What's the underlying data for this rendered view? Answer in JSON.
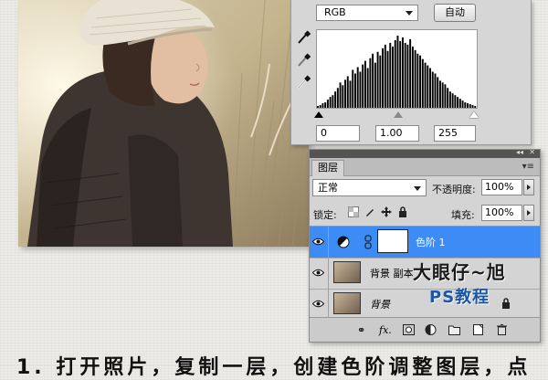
{
  "levels": {
    "channel": "RGB",
    "auto_label": "自动",
    "input_black": "0",
    "input_gamma": "1.00",
    "input_white": "255",
    "histogram_bins": [
      2,
      3,
      5,
      6,
      9,
      12,
      14,
      18,
      22,
      28,
      25,
      31,
      35,
      30,
      42,
      38,
      45,
      40,
      48,
      52,
      44,
      55,
      60,
      50,
      62,
      58,
      66,
      70,
      63,
      72,
      68,
      75,
      80,
      74,
      78,
      72,
      70,
      76,
      68,
      64,
      60,
      58,
      54,
      50,
      47,
      44,
      40,
      38,
      34,
      30,
      28,
      26,
      22,
      18,
      16,
      14,
      12,
      10,
      8,
      6,
      5,
      4,
      3,
      2
    ]
  },
  "layers_panel": {
    "tab_label": "图层",
    "blend_mode": "正常",
    "opacity_label": "不透明度:",
    "opacity_value": "100%",
    "lock_label": "锁定:",
    "fill_label": "填充:",
    "fill_value": "100%",
    "layers": [
      {
        "name": "色阶 1",
        "selected": true,
        "type": "adjustment"
      },
      {
        "name": "背景 副本",
        "selected": false,
        "type": "pixel"
      },
      {
        "name": "背景",
        "selected": false,
        "type": "pixel"
      }
    ]
  },
  "watermark": {
    "line1": "大眼仔~旭",
    "line2": "PS教程"
  },
  "caption": "1. 打开照片，复制一层，创建色阶调整图层，点"
}
